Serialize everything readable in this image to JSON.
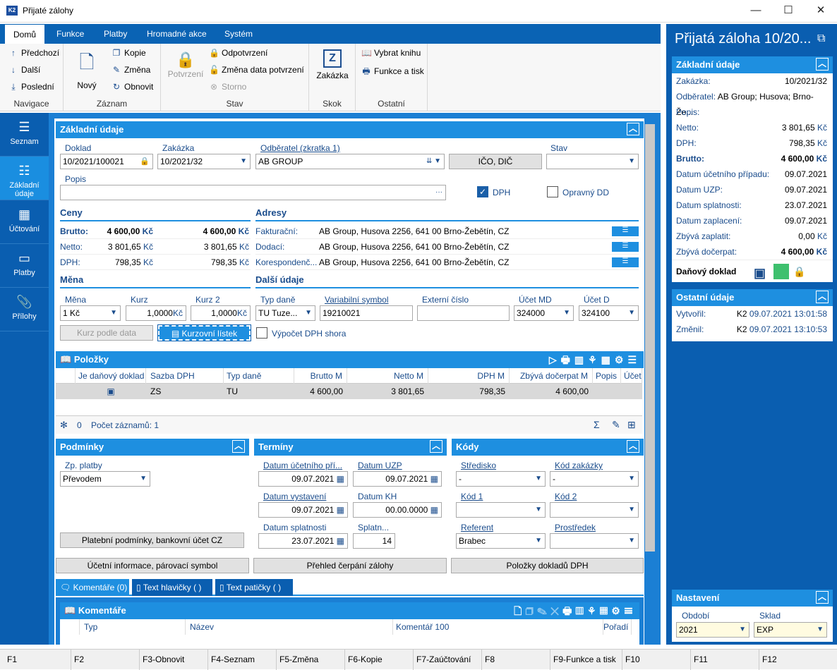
{
  "window": {
    "title": "Přijaté zálohy",
    "app_icon": "K2"
  },
  "ribbon": {
    "tabs": [
      "Domů",
      "Funkce",
      "Platby",
      "Hromadné akce",
      "Systém"
    ],
    "groups": {
      "navigace": {
        "label": "Navigace",
        "items": [
          "Předchozí",
          "Další",
          "Poslední"
        ]
      },
      "zaznam": {
        "label": "Záznam",
        "new": "Nový",
        "items": [
          "Kopie",
          "Změna",
          "Obnovit"
        ]
      },
      "stav": {
        "label": "Stav",
        "confirm": "Potvrzení",
        "items": [
          "Odpotvrzení",
          "Změna data potvrzení",
          "Storno"
        ]
      },
      "skok": {
        "label": "Skok",
        "big": "Zakázka"
      },
      "ostatni": {
        "label": "Ostatní",
        "items": [
          "Vybrat knihu",
          "Funkce a tisk"
        ]
      }
    }
  },
  "leftnav": [
    {
      "label": "Seznam",
      "icon": "list-icon"
    },
    {
      "label": "Základní údaje",
      "icon": "details-icon"
    },
    {
      "label": "Účtování",
      "icon": "calculator-icon"
    },
    {
      "label": "Platby",
      "icon": "box-icon"
    },
    {
      "label": "Přílohy",
      "icon": "paperclip-icon"
    }
  ],
  "basic": {
    "title": "Základní údaje",
    "doklad_label": "Doklad",
    "doklad": "10/2021/100021",
    "zakazka_label": "Zakázka",
    "zakazka": "10/2021/32",
    "odberatel_label": "Odběratel (zkratka 1)",
    "odberatel": "AB GROUP",
    "ico_button": "IČO, DIČ",
    "stav_label": "Stav",
    "stav": "",
    "popis_label": "Popis",
    "popis": "",
    "popis_more": "···",
    "dph_label": "DPH",
    "opravny_label": "Opravný DD"
  },
  "ceny": {
    "title": "Ceny",
    "rows": [
      {
        "label": "Brutto:",
        "v1": "4 600,00",
        "v2": "4 600,00",
        "bold": true
      },
      {
        "label": "Netto:",
        "v1": "3 801,65",
        "v2": "3 801,65",
        "bold": false
      },
      {
        "label": "DPH:",
        "v1": "798,35",
        "v2": "798,35",
        "bold": false
      }
    ],
    "currency": "Kč"
  },
  "adresy": {
    "title": "Adresy",
    "rows": [
      {
        "label": "Fakturační:",
        "value": "AB Group, Husova 2256, 641 00  Brno-Žebětín, CZ"
      },
      {
        "label": "Dodací:",
        "value": "AB Group, Husova 2256, 641 00  Brno-Žebětín, CZ"
      },
      {
        "label": "Korespondenč...",
        "value": "AB Group, Husova 2256, 641 00  Brno-Žebětín, CZ"
      }
    ]
  },
  "mena": {
    "title": "Měna",
    "mena_label": "Měna",
    "mena": "1 Kč",
    "kurz_label": "Kurz",
    "kurz": "1,0000",
    "kurz_unit": "Kč",
    "kurz2_label": "Kurz 2",
    "kurz2": "1,0000",
    "kurz2_unit": "Kč",
    "btn_kurz_data": "Kurz podle data",
    "btn_kurzovni": "Kurzovní lístek"
  },
  "dalsi": {
    "title": "Další údaje",
    "typ_dane_label": "Typ daně",
    "typ_dane": "TU  Tuze...",
    "vs_label": "Variabilní symbol",
    "vs": "19210021",
    "ext_label": "Externí číslo",
    "ext": "",
    "md_label": "Účet MD",
    "md": "324000",
    "d_label": "Účet D",
    "d": "324100",
    "vypocet_label": "Výpočet DPH shora"
  },
  "polozky": {
    "title": "Položky",
    "columns": [
      "Je daňový doklad",
      "Sazba DPH",
      "Typ daně",
      "Brutto M",
      "Netto M",
      "DPH M",
      "Zbývá dočerpat M",
      "Popis",
      "Účet"
    ],
    "rows": [
      {
        "sazba": "ZS",
        "typ": "TU",
        "brutto": "4 600,00",
        "netto": "3 801,65",
        "dph": "798,35",
        "zbyva": "4 600,00"
      }
    ],
    "footer_count": "0",
    "footer_label": "Počet záznamů: 1"
  },
  "podminky": {
    "title": "Podmínky",
    "zp_label": "Zp. platby",
    "zp": "Převodem",
    "btn": "Platební podmínky, bankovní účet CZ"
  },
  "terminy": {
    "title": "Termíny",
    "ucetni_label": "Datum účetního pří...",
    "ucetni": "09.07.2021",
    "uzp_label": "Datum UZP",
    "uzp": "09.07.2021",
    "vyst_label": "Datum vystavení",
    "vyst": "09.07.2021",
    "kh_label": "Datum KH",
    "kh": "00.00.0000",
    "splat_label": "Datum splatnosti",
    "splat": "23.07.2021",
    "splatn_label": "Splatn...",
    "splatn": "14"
  },
  "kody": {
    "title": "Kódy",
    "stredisko_label": "Středisko",
    "stredisko": "-",
    "kodzak_label": "Kód zakázky",
    "kodzak": "-",
    "kod1_label": "Kód 1",
    "kod1": "",
    "kod2_label": "Kód 2",
    "kod2": "",
    "referent_label": "Referent",
    "referent": "Brabec",
    "prostredek_label": "Prostředek",
    "prostredek": ""
  },
  "bottom_buttons": [
    "Účetní informace, párovací symbol",
    "Přehled čerpání zálohy",
    "Položky dokladů DPH"
  ],
  "bottom_tabs": [
    "Komentáře (0)",
    "Text hlavičky ( )",
    "Text patičky ( )"
  ],
  "komentare": {
    "title": "Komentáře",
    "columns": [
      "Typ",
      "Název",
      "Komentář 100",
      "Pořadí"
    ]
  },
  "right": {
    "title": "Přijatá záloha 10/20...",
    "basic_title": "Základní údaje",
    "rows": [
      {
        "label": "Zakázka:",
        "value": "10/2021/32"
      },
      {
        "label": "Odběratel:",
        "value": "AB Group; Husova; Brno-Že..."
      },
      {
        "label": "Popis:",
        "value": ""
      },
      {
        "label": "Netto:",
        "value": "3 801,65"
      },
      {
        "label": "DPH:",
        "value": "798,35"
      },
      {
        "label": "Brutto:",
        "value": "4 600,00"
      },
      {
        "label": "Datum účetního případu:",
        "value": "09.07.2021"
      },
      {
        "label": "Datum UZP:",
        "value": "09.07.2021"
      },
      {
        "label": "Datum splatnosti:",
        "value": "23.07.2021"
      },
      {
        "label": "Datum zaplacení:",
        "value": "09.07.2021"
      },
      {
        "label": "Zbývá zaplatit:",
        "value": "0,00"
      },
      {
        "label": "Zbývá dočerpat:",
        "value": "4 600,00"
      }
    ],
    "danovy": "Daňový doklad",
    "ostatni_title": "Ostatní údaje",
    "vytvoril_label": "Vytvořil:",
    "vytvoril_user": "K2",
    "vytvoril_date": "09.07.2021 13:01:58",
    "zmenil_label": "Změnil:",
    "zmenil_user": "K2",
    "zmenil_date": "09.07.2021 13:10:53",
    "nastaveni_title": "Nastavení",
    "obdobi_label": "Období",
    "obdobi": "2021",
    "sklad_label": "Sklad",
    "sklad": "EXP"
  },
  "statusbar": [
    "F1",
    "F2",
    "F3-Obnovit",
    "F4-Seznam",
    "F5-Změna",
    "F6-Kopie",
    "F7-Zaúčtování",
    "F8",
    "F9-Funkce a tisk",
    "F10",
    "F11",
    "F12"
  ],
  "colors": {
    "accent": "#1e8fe0",
    "nav": "#0a5eb0"
  }
}
